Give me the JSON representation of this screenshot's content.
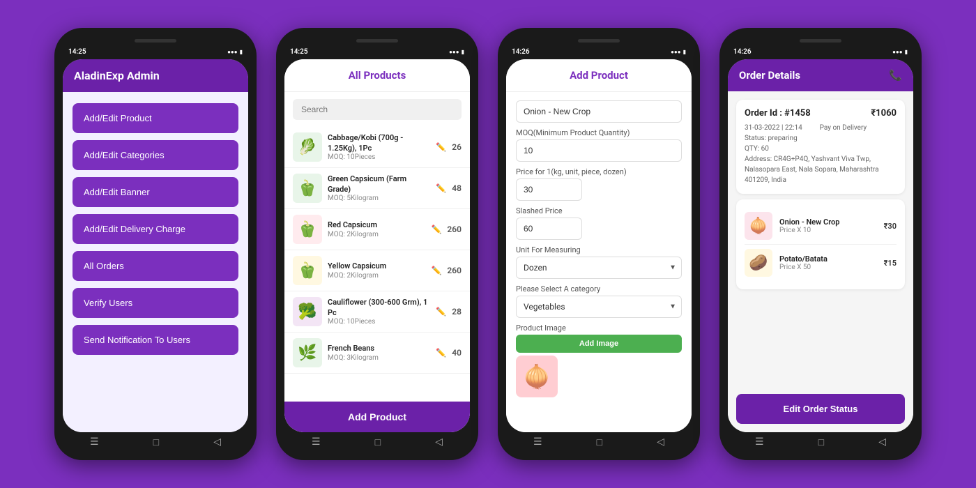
{
  "app": {
    "background_color": "#7B2FBE"
  },
  "phone1": {
    "time": "14:25",
    "header_title": "AladinExp Admin",
    "header_bg": "#6B21A8",
    "menu_items": [
      "Add/Edit Product",
      "Add/Edit Categories",
      "Add/Edit Banner",
      "Add/Edit Delivery Charge",
      "All Orders",
      "Verify Users",
      "Send Notification To Users"
    ]
  },
  "phone2": {
    "time": "14:25",
    "screen_title": "All Products",
    "search_placeholder": "Search",
    "products": [
      {
        "name": "Cabbage/Kobi (700g - 1.25Kg), 1Pc",
        "moq": "MOQ: 10Pieces",
        "count": "26",
        "emoji": "🥬"
      },
      {
        "name": "Green Capsicum (Farm Grade)",
        "moq": "MOQ: 5Kilogram",
        "count": "48",
        "emoji": "🫑"
      },
      {
        "name": "Red Capsicum",
        "moq": "MOQ: 2Kilogram",
        "count": "260",
        "emoji": "🫑"
      },
      {
        "name": "Yellow Capsicum",
        "moq": "MOQ: 2Kilogram",
        "count": "260",
        "emoji": "🫑"
      },
      {
        "name": "Cauliflower (300-600 Grm), 1 Pc",
        "moq": "MOQ: 10Pieces",
        "count": "28",
        "emoji": "🥦"
      },
      {
        "name": "French Beans",
        "moq": "MOQ: 3Kilogram",
        "count": "40",
        "emoji": "🌿"
      }
    ],
    "add_product_label": "Add Product"
  },
  "phone3": {
    "time": "14:26",
    "screen_title": "Add Product",
    "product_name_value": "Onion - New Crop",
    "moq_label": "MOQ(Minimum Product Quantity)",
    "moq_value": "10",
    "price_label": "Price for 1(kg, unit, piece, dozen)",
    "price_value": "30",
    "slashed_price_label": "Slashed Price",
    "slashed_price_value": "60",
    "unit_label": "Unit For Measuring",
    "unit_value": "Dozen",
    "category_label": "Please Select A category",
    "category_value": "Vegetables",
    "product_image_label": "Product Image",
    "add_image_label": "Add Image",
    "product_emoji": "🧅"
  },
  "phone4": {
    "time": "14:26",
    "screen_title": "Order Details",
    "order_id": "Order Id : #1458",
    "order_amount": "₹1060",
    "order_date": "31-03-2022 | 22:14",
    "payment_method": "Pay on Delivery",
    "status_label": "Status:",
    "status_value": "preparing",
    "qty_label": "QTY:",
    "qty_value": "60",
    "address_label": "Address:",
    "address_value": "CR4G+P4Q, Yashvant Viva Twp, Nalasopara East, Nala Sopara, Maharashtra 401209, India",
    "order_items": [
      {
        "name": "Onion - New Crop",
        "qty": "Price X 10",
        "price": "₹30",
        "emoji": "🧅",
        "bg": "#fce4ec"
      },
      {
        "name": "Potato/Batata",
        "qty": "Price X 50",
        "price": "₹15",
        "emoji": "🥔",
        "bg": "#fff8e1"
      }
    ],
    "edit_order_label": "Edit Order Status"
  }
}
